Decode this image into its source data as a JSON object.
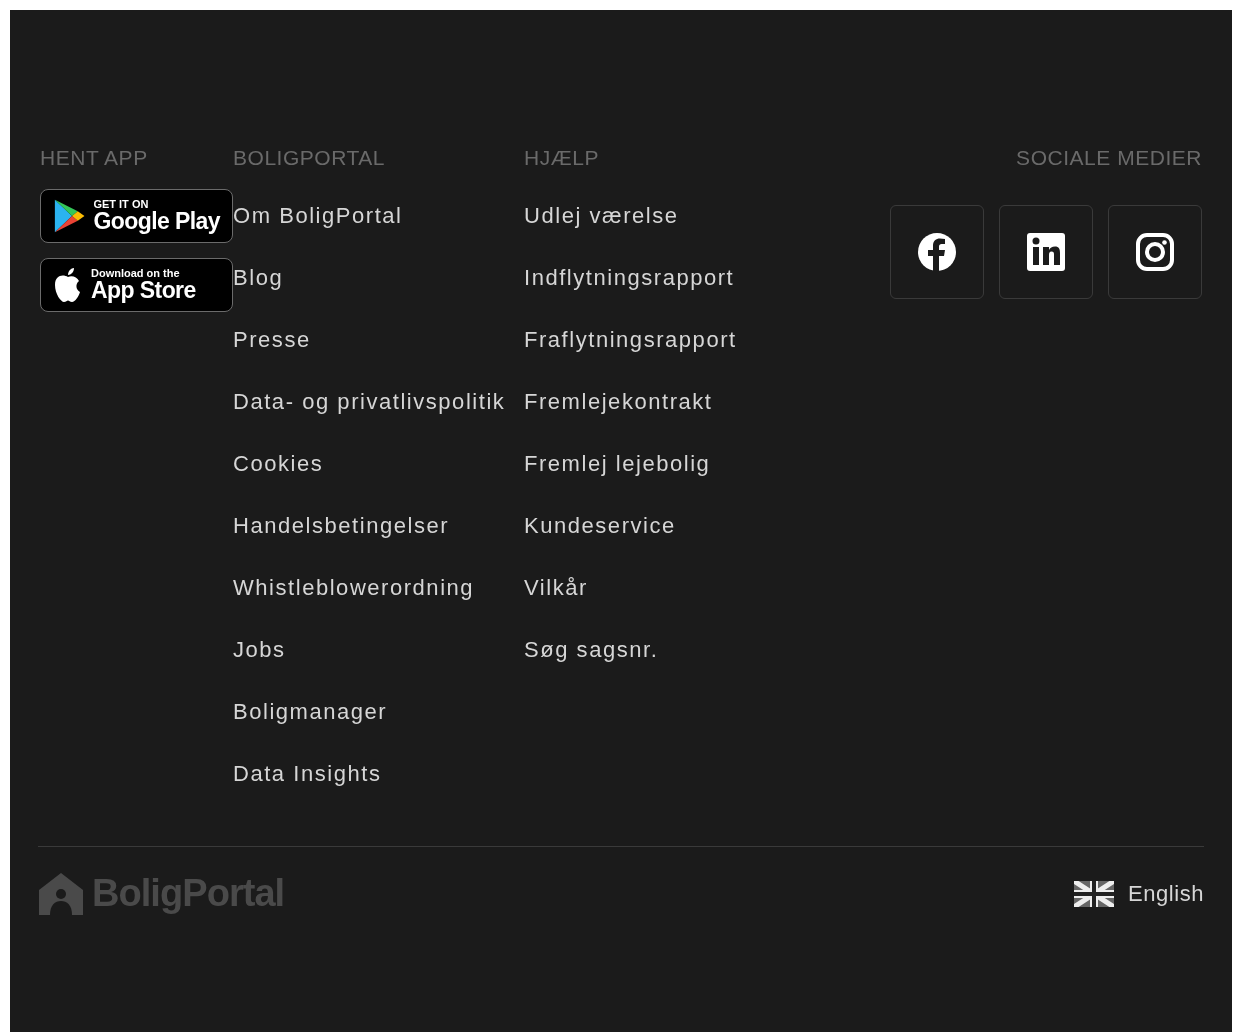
{
  "get_app": {
    "heading": "HENT APP",
    "badges": [
      {
        "kind": "google",
        "small": "GET IT ON",
        "big": "Google Play"
      },
      {
        "kind": "apple",
        "small": "Download on the",
        "big": "App Store"
      }
    ]
  },
  "boligportal": {
    "heading": "BOLIGPORTAL",
    "links": [
      "Om BoligPortal",
      "Blog",
      "Presse",
      "Data- og privatlivspolitik",
      "Cookies",
      "Handelsbetingelser",
      "Whistleblowerordning",
      "Jobs",
      "Boligmanager",
      "Data Insights"
    ]
  },
  "help": {
    "heading": "HJÆLP",
    "links": [
      "Udlej værelse",
      "Indflytningsrapport",
      "Fraflytningsrapport",
      "Fremlejekontrakt",
      "Fremlej lejebolig",
      "Kundeservice",
      "Vilkår",
      "Søg sagsnr."
    ]
  },
  "social": {
    "heading": "SOCIALE MEDIER",
    "links": [
      {
        "kind": "facebook"
      },
      {
        "kind": "linkedin"
      },
      {
        "kind": "instagram"
      }
    ]
  },
  "bottom": {
    "logo": "BoligPortal",
    "language": "English"
  }
}
